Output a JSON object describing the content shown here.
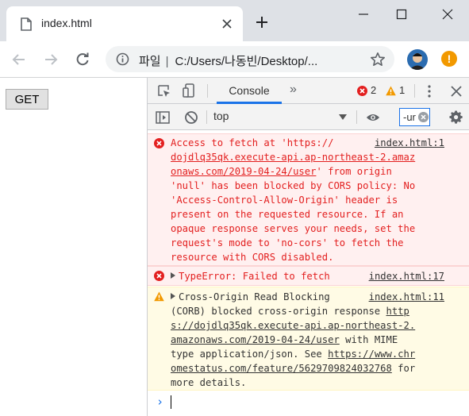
{
  "tab": {
    "title": "index.html"
  },
  "omnibox": {
    "scheme_label": "파일",
    "url": "C:/Users/나동빈/Desktop/..."
  },
  "page": {
    "get_button_label": "GET"
  },
  "devtools": {
    "console_tab": "Console",
    "error_count": "2",
    "warning_count": "1",
    "context": "top",
    "filter_value": "-ur"
  },
  "messages": {
    "cors": {
      "lines": [
        "Access to fetch at 'https://",
        "dojdlq35qk.execute-api.ap-northeast-2.amaz",
        "onaws.com/2019-04-24/user' from origin",
        "'null' has been blocked by CORS policy: No",
        "'Access-Control-Allow-Origin' header is",
        "present on the requested resource. If an",
        "opaque response serves your needs, set the",
        "request's mode to 'no-cors' to fetch the",
        "resource with CORS disabled."
      ],
      "source": "index.html:1"
    },
    "typeerror": {
      "text": "TypeError: Failed to fetch",
      "source": "index.html:17"
    },
    "corb": {
      "lines": [
        "Cross-Origin Read Blocking",
        "(CORB) blocked cross-origin response http",
        "s://dojdlq35qk.execute-api.ap-northeast-2.",
        "amazonaws.com/2019-04-24/user with MIME",
        "type application/json. See https://www.chr",
        "omestatus.com/feature/5629709824032768 for",
        "more details."
      ],
      "source": "index.html:11"
    }
  },
  "colors": {
    "error": "#e32020",
    "warning": "#f29900",
    "accent": "#1a73e8"
  }
}
